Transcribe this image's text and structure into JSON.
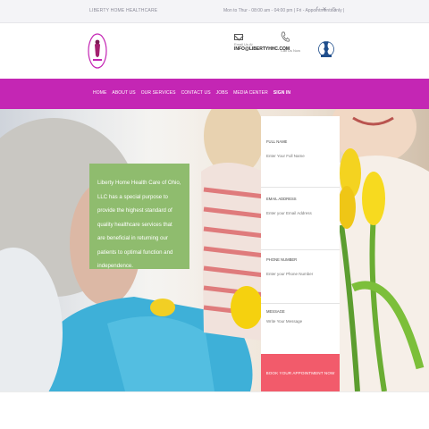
{
  "topbar": {
    "brand": "LIBERTY HOME HEALTHCARE",
    "hours": "Mon to Thur - 08:00 am - 04:00 pm | Fri - Appointments only |",
    "social": [
      "f",
      "✕",
      "◎"
    ]
  },
  "header": {
    "email_label": "Email Us At",
    "email_value": "INFO@LIBERTYHHC.COM",
    "call_label": "Call Us Now"
  },
  "nav": {
    "items": [
      "HOME",
      "ABOUT US",
      "OUR SERVICES",
      "CONTACT US",
      "JOBS",
      "MEDIA CENTER",
      "SIGN IN"
    ]
  },
  "hero": {
    "info_text": "Liberty Home Health Care of Ohio, LLC has a special purpose to provide the highest standard of quality healthcare services that are beneficial in returning our patients to optimal function and independence."
  },
  "form": {
    "full_name_label": "FULL NAME",
    "full_name_placeholder": "Enter Your Full Name",
    "email_label": "EMAIL ADDRESS",
    "email_placeholder": "Enter your Email Address",
    "phone_label": "PHONE NUMBER",
    "phone_placeholder": "Enter your Phone Number",
    "message_label": "MESSAGE",
    "message_placeholder": "Write Your Message",
    "book_label": "BOOK YOUR APPOINTMENT NOW"
  },
  "colors": {
    "nav_bg": "#c426b4",
    "info_box_bg": "#8fbc6e",
    "book_button_bg": "#f25b6b"
  }
}
